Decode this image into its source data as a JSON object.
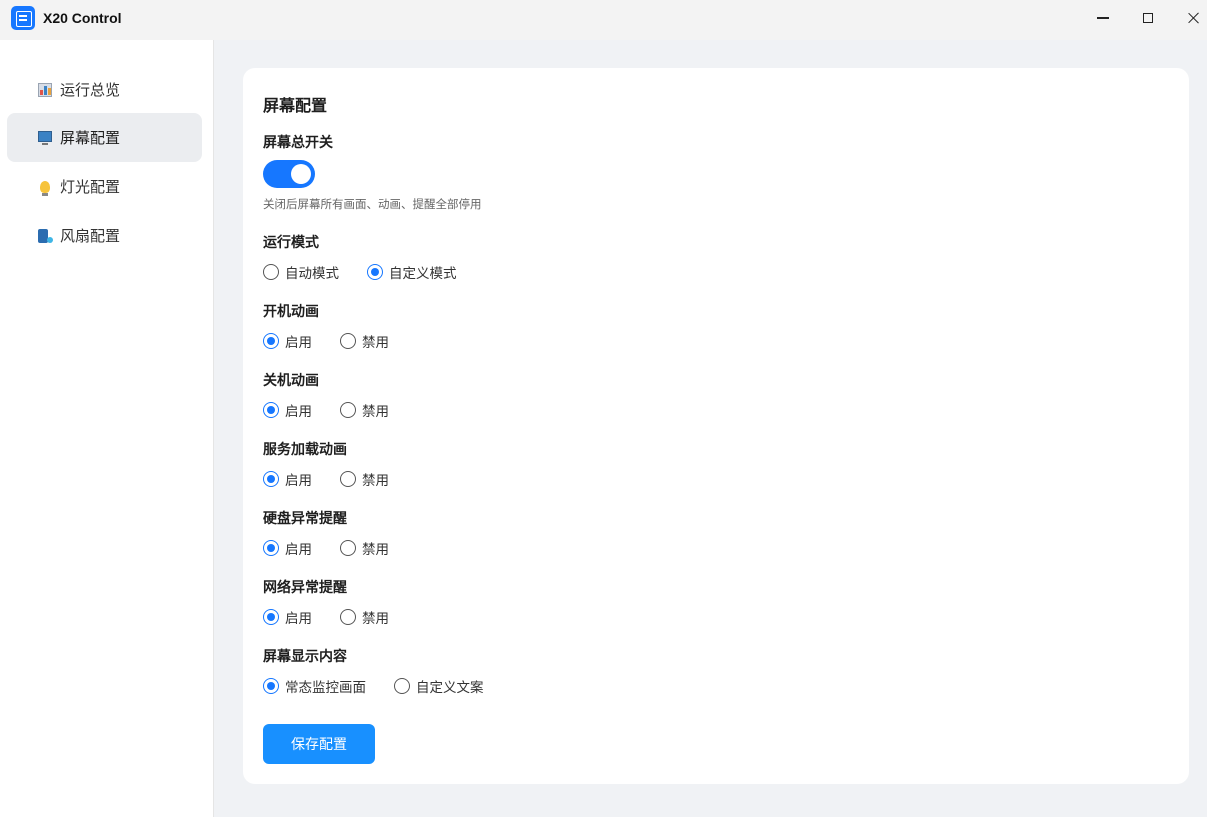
{
  "window": {
    "title": "X20 Control"
  },
  "sidebar": {
    "items": [
      {
        "label": "运行总览",
        "icon": "bar-chart-icon",
        "active": false
      },
      {
        "label": "屏幕配置",
        "icon": "monitor-icon",
        "active": true
      },
      {
        "label": "灯光配置",
        "icon": "lightbulb-icon",
        "active": false
      },
      {
        "label": "风扇配置",
        "icon": "fan-icon",
        "active": false
      }
    ]
  },
  "card": {
    "title": "屏幕配置",
    "master_switch": {
      "label": "屏幕总开关",
      "on": true,
      "hint": "关闭后屏幕所有画面、动画、提醒全部停用"
    },
    "run_mode": {
      "label": "运行模式",
      "options": [
        "自动模式",
        "自定义模式"
      ],
      "selected": "自定义模式"
    },
    "boot_animation": {
      "label": "开机动画",
      "options": [
        "启用",
        "禁用"
      ],
      "selected": "启用"
    },
    "shutdown_animation": {
      "label": "关机动画",
      "options": [
        "启用",
        "禁用"
      ],
      "selected": "启用"
    },
    "service_loading_animation": {
      "label": "服务加载动画",
      "options": [
        "启用",
        "禁用"
      ],
      "selected": "启用"
    },
    "disk_error_alert": {
      "label": "硬盘异常提醒",
      "options": [
        "启用",
        "禁用"
      ],
      "selected": "启用"
    },
    "network_error_alert": {
      "label": "网络异常提醒",
      "options": [
        "启用",
        "禁用"
      ],
      "selected": "启用"
    },
    "display_content": {
      "label": "屏幕显示内容",
      "options": [
        "常态监控画面",
        "自定义文案"
      ],
      "selected": "常态监控画面"
    },
    "save_label": "保存配置"
  },
  "colors": {
    "accent": "#1677ff",
    "button": "#1890ff",
    "active_nav_bg": "#ebedf0",
    "page_bg": "#f0f2f5"
  }
}
